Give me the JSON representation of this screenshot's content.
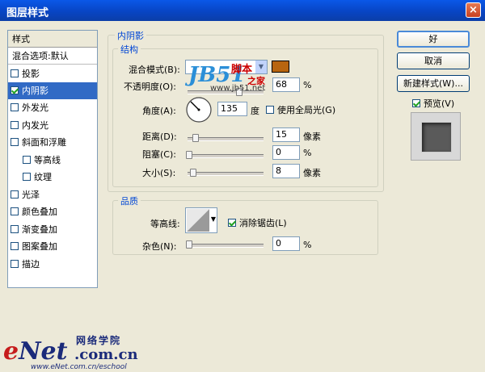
{
  "window": {
    "title": "图层样式",
    "close": "×"
  },
  "sidebar": {
    "header": "样式",
    "items": [
      {
        "label": "混合选项:默认",
        "checkbox": false
      },
      {
        "label": "投影",
        "checkbox": true,
        "checked": false
      },
      {
        "label": "内阴影",
        "checkbox": true,
        "checked": true
      },
      {
        "label": "外发光",
        "checkbox": true,
        "checked": false
      },
      {
        "label": "内发光",
        "checkbox": true,
        "checked": false
      },
      {
        "label": "斜面和浮雕",
        "checkbox": true,
        "checked": false
      },
      {
        "label": "等高线",
        "checkbox": true,
        "checked": false
      },
      {
        "label": "纹理",
        "checkbox": true,
        "checked": false
      },
      {
        "label": "光泽",
        "checkbox": true,
        "checked": false
      },
      {
        "label": "颜色叠加",
        "checkbox": true,
        "checked": false
      },
      {
        "label": "渐变叠加",
        "checkbox": true,
        "checked": false
      },
      {
        "label": "图案叠加",
        "checkbox": true,
        "checked": false
      },
      {
        "label": "描边",
        "checkbox": true,
        "checked": false
      }
    ]
  },
  "inner_shadow": {
    "title": "内阴影",
    "structure_title": "结构",
    "blend_mode_label": "混合模式(B):",
    "shadow_color": "#b8650f",
    "opacity_label": "不透明度(O):",
    "opacity_value": "68",
    "opacity_unit": "%",
    "angle_label": "角度(A):",
    "angle_value": "135",
    "angle_unit": "度",
    "global_light_label": "使用全局光(G)",
    "distance_label": "距离(D):",
    "distance_value": "15",
    "distance_unit": "像素",
    "choke_label": "阻塞(C):",
    "choke_value": "0",
    "choke_unit": "%",
    "size_label": "大小(S):",
    "size_value": "8",
    "size_unit": "像素",
    "quality_title": "品质",
    "contour_label": "等高线:",
    "antialias_label": "消除锯齿(L)",
    "noise_label": "杂色(N):",
    "noise_value": "0",
    "noise_unit": "%"
  },
  "buttons": {
    "ok": "好",
    "cancel": "取消",
    "new_style": "新建样式(W)...",
    "preview": "预览(V)"
  },
  "watermarks": {
    "jb51_logo": "JB51",
    "jb51_cn": "脚本",
    "jb51_home": "之家",
    "jb51_url": "www.jb51.net",
    "enet_logo_e": "e",
    "enet_logo_rest": "Net",
    "enet_cn": ".com.cn",
    "enet_school": "网络学院",
    "enet_url": "www.eNet.com.cn/eschool"
  }
}
